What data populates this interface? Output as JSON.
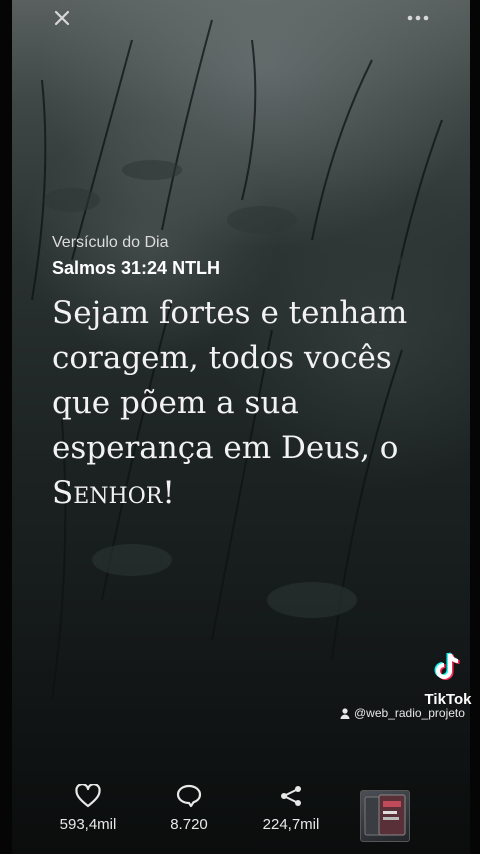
{
  "topbar": {
    "close_icon": "close-icon",
    "more_icon": "more-icon"
  },
  "post": {
    "heading": "Versículo do Dia",
    "reference": "Salmos 31:24 NTLH",
    "verse_main": "Sejam fortes e tenham coragem, todos vocês que põem a sua esperança em Deus, o ",
    "verse_smallcaps": "Senhor",
    "verse_end": "!"
  },
  "watermark": {
    "brand": "TikTok",
    "handle": "@web_radio_projeto"
  },
  "actions": {
    "likes": "593,4mil",
    "comments": "8.720",
    "shares": "224,7mil"
  },
  "colors": {
    "text": "#ffffff",
    "accent_cyan": "#25f4ee",
    "accent_red": "#fe2c55"
  }
}
